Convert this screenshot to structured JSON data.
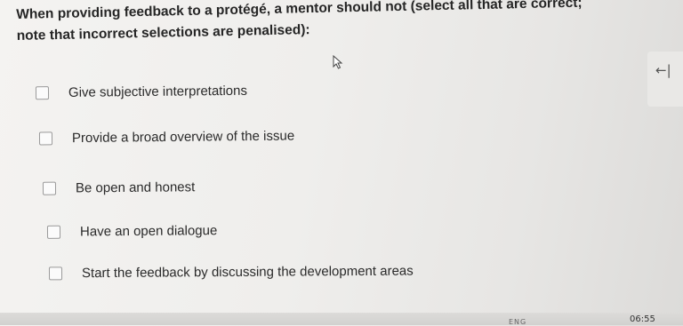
{
  "question": {
    "line1": "When providing feedback to a protégé, a mentor should not (select all that are correct;",
    "line2": "note that incorrect selections are penalised):"
  },
  "options": [
    {
      "label": "Give subjective interpretations",
      "checked": false
    },
    {
      "label": "Provide a broad overview of the issue",
      "checked": false
    },
    {
      "label": "Be open and honest",
      "checked": false
    },
    {
      "label": "Have an open dialogue",
      "checked": false
    },
    {
      "label": "Start the feedback by discussing the development areas",
      "checked": false
    }
  ],
  "side_panel": {
    "icon": "collapse-left-icon",
    "glyph": "←|"
  },
  "taskbar": {
    "clock": "06:55",
    "tray_label": "ENG"
  }
}
